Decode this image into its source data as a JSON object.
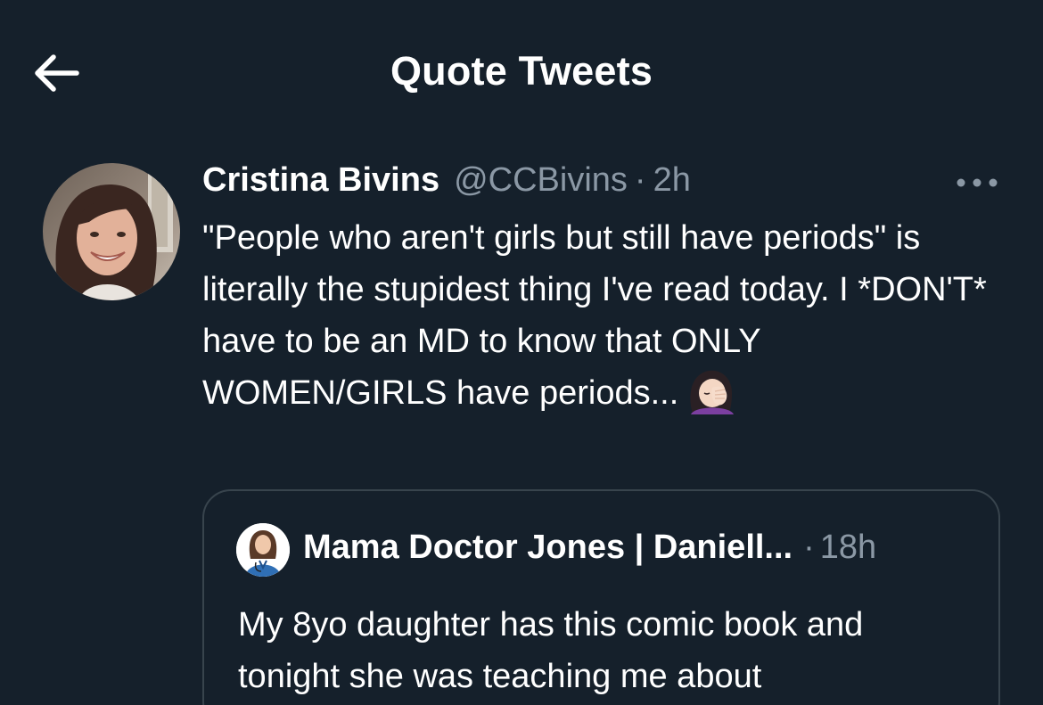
{
  "header": {
    "back_icon": "arrow-left-icon",
    "title": "Quote Tweets"
  },
  "tweet": {
    "author_name": "Cristina Bivins",
    "author_handle": "@CCBivins",
    "separator": "·",
    "time": "2h",
    "more_icon": "more-horizontal-icon",
    "text": "\"People who aren't girls but still have periods\" is literally the stupidest thing I've read today. I *DON'T* have to be an MD to know that ONLY WOMEN/GIRLS have periods...",
    "emoji": "woman-facepalming-emoji"
  },
  "quoted_tweet": {
    "author_name": "Mama Doctor Jones | Daniell...",
    "separator": "·",
    "time": "18h",
    "text": "My 8yo daughter has this comic book and tonight she was teaching me about"
  },
  "colors": {
    "background": "#15202b",
    "text_primary": "#ffffff",
    "text_secondary": "#8b98a5",
    "border": "#38444d"
  }
}
